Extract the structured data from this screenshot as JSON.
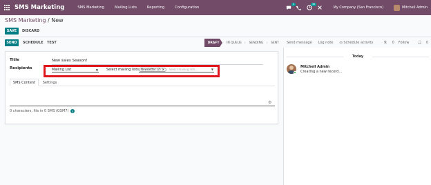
{
  "navbar": {
    "app_name": "SMS Marketing",
    "menu": [
      "SMS Marketing",
      "Mailing Lists",
      "Reporting",
      "Configuration"
    ],
    "chat_badge": "4",
    "activity_badge": "38",
    "company": "My Company (San Francisco)",
    "user": "Mitchell Admin",
    "icons": [
      "apps-grid-icon",
      "chat-icon",
      "phone-icon",
      "clock-icon",
      "close-icon"
    ]
  },
  "breadcrumb": {
    "parent": "SMS Marketing",
    "separator": " / ",
    "current": "New"
  },
  "form_buttons": {
    "save": "SAVE",
    "discard": "DISCARD"
  },
  "statusbar": {
    "send": "SEND",
    "schedule": "SCHEDULE",
    "test": "TEST",
    "stages": [
      "DRAFT",
      "IN QUEUE",
      "SENDING",
      "SENT"
    ],
    "active_stage": "DRAFT"
  },
  "chatter_top": {
    "send_message": "Send message",
    "log_note": "Log note",
    "schedule_activity": "Schedule activity",
    "attachments": "0",
    "follow": "Follow",
    "followers": "0"
  },
  "form": {
    "title_label": "Title",
    "title_value": "New sales Season!",
    "recipients_label": "Recipients",
    "recipients_mode": "Mailing List",
    "lists_label": "Select mailing lists:",
    "list_tag": "Newsletter (7)",
    "list_placeholder": "Select mailing lists...",
    "tabs": [
      "SMS Content",
      "Settings"
    ],
    "char_count": "0 characters, fits in 0 SMS (GSM7)"
  },
  "chatter": {
    "date_divider": "Today",
    "messages": [
      {
        "author": "Mitchell Admin",
        "text": "Creating a new record..."
      }
    ]
  },
  "colors": {
    "brand": "#714b67",
    "primary": "#017e84",
    "highlight": "#e0161d"
  }
}
